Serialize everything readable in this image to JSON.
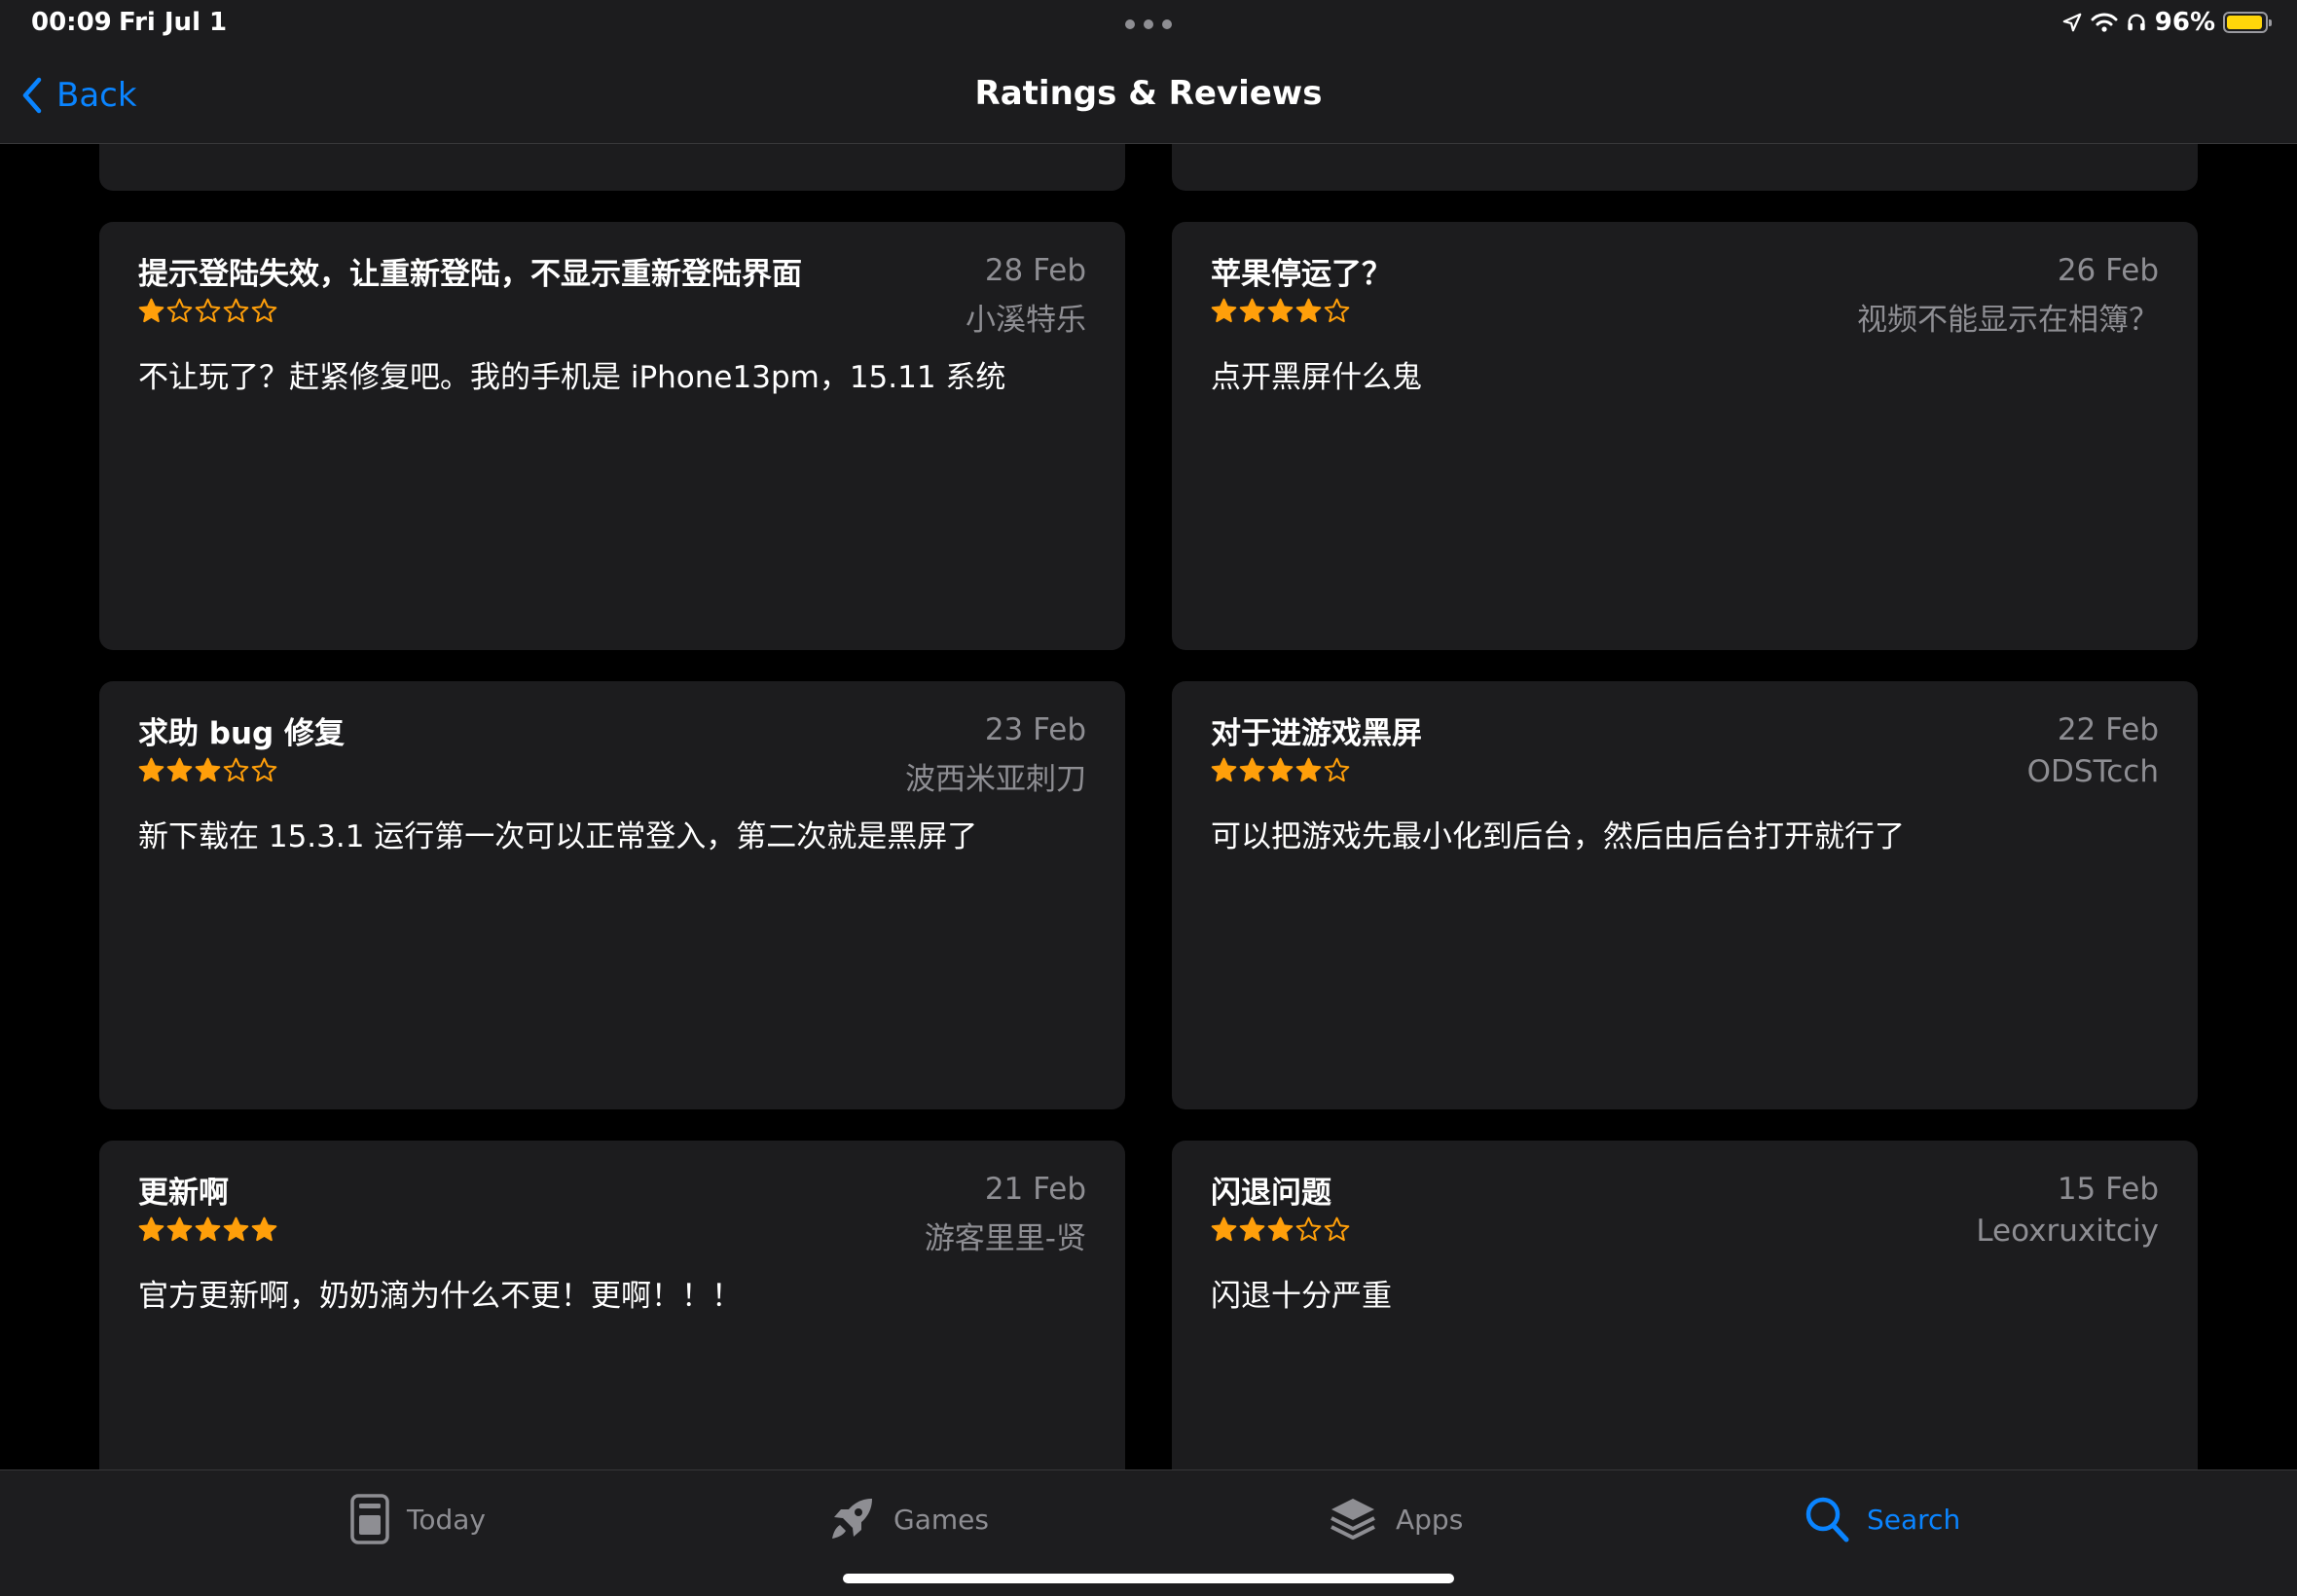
{
  "status_bar": {
    "time": "00:09",
    "date": "Fri Jul 1",
    "battery_percent": "96%",
    "battery_level": 0.96
  },
  "nav": {
    "back_label": "Back",
    "title": "Ratings & Reviews"
  },
  "colors": {
    "accent": "#0a84ff",
    "star": "#ff9f0a",
    "card_bg": "#1c1c1e",
    "secondary_text": "#8e8e93",
    "battery": "#ffd60a"
  },
  "reviews": [
    {
      "title": "提示登陆失效，让重新登陆，不显示重新登陆界面",
      "date": "28 Feb",
      "author": "小溪特乐",
      "rating": 1,
      "body": "不让玩了？赶紧修复吧。我的手机是 iPhone13pm，15.11 系统"
    },
    {
      "title": "苹果停运了？",
      "date": "26 Feb",
      "author": "视频不能显示在相簿？",
      "rating": 4,
      "body": "点开黑屏什么鬼"
    },
    {
      "title": "求助 bug 修复",
      "date": "23 Feb",
      "author": "波西米亚刺刀",
      "rating": 3,
      "body": "新下载在 15.3.1 运行第一次可以正常登入，第二次就是黑屏了"
    },
    {
      "title": "对于进游戏黑屏",
      "date": "22 Feb",
      "author": "ODSTcch",
      "rating": 4,
      "body": "可以把游戏先最小化到后台，然后由后台打开就行了"
    },
    {
      "title": "更新啊",
      "date": "21 Feb",
      "author": "游客里里-贤",
      "rating": 5,
      "body": "官方更新啊，奶奶滴为什么不更！更啊！！！"
    },
    {
      "title": "闪退问题",
      "date": "15 Feb",
      "author": "Leoxruxitciy",
      "rating": 3,
      "body": "闪退十分严重"
    }
  ],
  "tab_bar": {
    "tabs": [
      {
        "label": "Today",
        "icon": "today-icon",
        "active": false
      },
      {
        "label": "Games",
        "icon": "rocket-icon",
        "active": false
      },
      {
        "label": "Apps",
        "icon": "apps-stack-icon",
        "active": false
      },
      {
        "label": "Search",
        "icon": "search-icon",
        "active": true
      }
    ]
  }
}
